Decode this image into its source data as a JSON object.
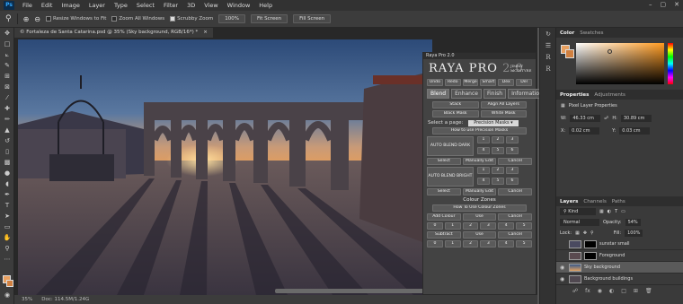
{
  "app": {
    "logo": "Ps"
  },
  "menu": [
    "File",
    "Edit",
    "Image",
    "Layer",
    "Type",
    "Select",
    "Filter",
    "3D",
    "View",
    "Window",
    "Help"
  ],
  "window_controls": [
    "–",
    "▢",
    "✕"
  ],
  "options": {
    "resize_windows": "Resize Windows to Fit",
    "zoom_all": "Zoom All Windows",
    "scrubby_zoom": "Scrubby Zoom",
    "zoom_100": "100%",
    "fit_screen": "Fit Screen",
    "fill_screen": "Fill Screen"
  },
  "document": {
    "tab_title": "© Fortaleza de Santa Catarina.psd @ 35% (Sky background, RGB/16*) *",
    "close": "×",
    "zoom": "35%",
    "doc_size": "Doc: 114.5M/1.24G"
  },
  "raya": {
    "header": "Raya Pro 2.0",
    "logo": "RAYA PRO",
    "version": "2.0",
    "author": "JIMMY MCINTYRE",
    "top_buttons": [
      "Undo",
      "Redo",
      "Merge",
      "Smart",
      "Dex",
      "Del"
    ],
    "tabs": [
      "Blend",
      "Enhance",
      "Finish",
      "Information"
    ],
    "stack": "Stack",
    "align_all": "Align All Layers",
    "black_mask": "Black Mask",
    "white_mask": "White Mask",
    "select_page_label": "Select a page:",
    "select_page_value": "Precision Masks",
    "how_precision": "How to use Precision Masks",
    "auto_dark": "AUTO BLEND DARK",
    "auto_bright": "AUTO BLEND BRIGHT",
    "nums_dark": [
      "1",
      "2",
      "3",
      "4",
      "5",
      "6"
    ],
    "nums_bright": [
      "1",
      "2",
      "3",
      "4",
      "5",
      "6"
    ],
    "select": "Select",
    "manually_edit": "Manually Edit",
    "cancel": "Cancel",
    "colour_zones": "Colour Zones",
    "how_colour": "How To Use Colour Zones",
    "add_colour": "Add Colour",
    "subtract": "Subtract",
    "use": "Use",
    "nums_zone": [
      "0",
      "1",
      "2",
      "3",
      "4",
      "5"
    ]
  },
  "color_panel": {
    "tabs": [
      "Color",
      "Swatches"
    ],
    "fg": "#e8a060",
    "bg": "#d08040"
  },
  "properties": {
    "tabs": [
      "Properties",
      "Adjustments"
    ],
    "title": "Pixel Layer Properties",
    "w": "46.33 cm",
    "h": "30.89 cm",
    "x": "0.02 cm",
    "y": "0.03 cm",
    "w_label": "W:",
    "h_label": "H:",
    "x_label": "X:",
    "y_label": "Y:"
  },
  "layers": {
    "tabs": [
      "Layers",
      "Channels",
      "Paths"
    ],
    "kind": "Kind",
    "blend_mode": "Normal",
    "opacity_label": "Opacity:",
    "opacity": "54%",
    "lock_label": "Lock:",
    "fill_label": "Fill:",
    "fill": "100%",
    "items": [
      {
        "name": "sunstar small",
        "visible": false,
        "mask": true,
        "selected": false
      },
      {
        "name": "Foreground",
        "visible": false,
        "mask": true,
        "selected": false
      },
      {
        "name": "Sky background",
        "visible": true,
        "mask": false,
        "selected": true
      },
      {
        "name": "Background buildings",
        "visible": true,
        "mask": false,
        "selected": false
      }
    ]
  }
}
